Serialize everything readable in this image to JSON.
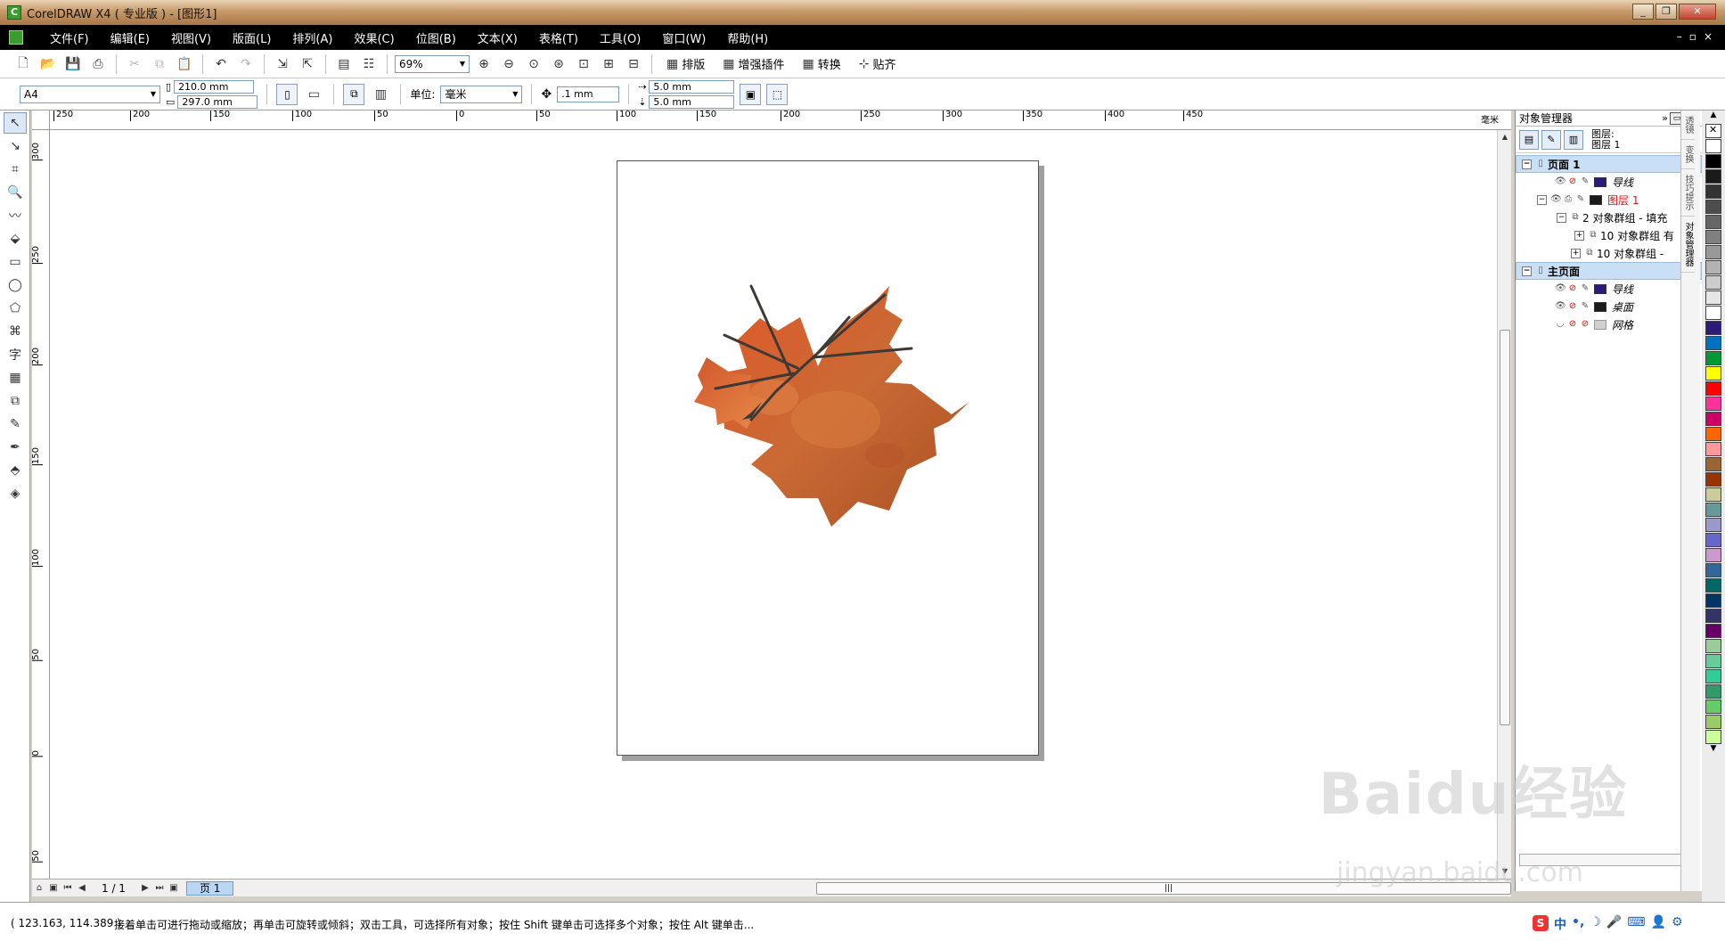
{
  "window": {
    "title": "CorelDRAW X4 ( 专业版 ) - [图形1]"
  },
  "menu": {
    "items": [
      "文件(F)",
      "编辑(E)",
      "视图(V)",
      "版面(L)",
      "排列(A)",
      "效果(C)",
      "位图(B)",
      "文本(X)",
      "表格(T)",
      "工具(O)",
      "窗口(W)",
      "帮助(H)"
    ]
  },
  "toolbar": {
    "zoom_value": "69%",
    "btn_layout": "排版",
    "btn_plugin": "增强插件",
    "btn_convert": "转换",
    "btn_snap": "贴齐"
  },
  "property_bar": {
    "paper_size": "A4",
    "width": "210.0 mm",
    "height": "297.0 mm",
    "unit_label": "单位:",
    "unit_value": "毫米",
    "nudge": ".1 mm",
    "dup_x": "5.0 mm",
    "dup_y": "5.0 mm"
  },
  "ruler": {
    "horizontal_labels": [
      "250",
      "200",
      "150",
      "100",
      "50",
      "0",
      "50",
      "100",
      "150",
      "200",
      "250",
      "300",
      "350",
      "400",
      "450"
    ],
    "h_unit": "毫米",
    "vertical_labels": [
      "300",
      "250",
      "200",
      "150",
      "100",
      "50",
      "0",
      "50"
    ]
  },
  "pagenav": {
    "count": "1 / 1",
    "tab": "页 1"
  },
  "status": {
    "coords": "( 123.163, 114.389 )",
    "hint": "接着单击可进行拖动或缩放；再单击可旋转或倾斜；双击工具，可选择所有对象；按住 Shift 键单击可选择多个对象；按住 Alt 键单击..."
  },
  "object_manager": {
    "title": "对象管理器",
    "layer_label_1": "图层:",
    "layer_label_2": "图层 1",
    "page1": "页面 1",
    "guides": "导线",
    "layer1": "图层 1",
    "group_2": "2 对象群组 - 填充",
    "group_10a": "10 对象群组 有",
    "group_10b": "10 对象群组 -",
    "master": "主页面",
    "master_guides": "导线",
    "master_desktop": "桌面",
    "master_grid": "网格"
  },
  "side_tabs": [
    "透镜",
    "变换",
    "技巧提示",
    "对象管理器"
  ],
  "palette": {
    "colors": [
      "#ffffff",
      "#000000",
      "#1a1a1a",
      "#333333",
      "#4d4d4d",
      "#666666",
      "#808080",
      "#999999",
      "#b3b3b3",
      "#cccccc",
      "#e6e6e6",
      "#ffffff",
      "#2e1a78",
      "#0070c0",
      "#009933",
      "#ffff00",
      "#ff0000",
      "#ff3399",
      "#cc0066",
      "#ff6600",
      "#ff9999",
      "#996633",
      "#993300",
      "#cccc99",
      "#669999",
      "#9999cc",
      "#6666cc",
      "#cc99cc",
      "#336699",
      "#006666",
      "#003366",
      "#333366",
      "#660066",
      "#99cc99",
      "#66cc99",
      "#33cc99",
      "#339966",
      "#66cc66",
      "#99cc66",
      "#ccff99"
    ]
  },
  "watermark": {
    "main": "Baidu经验",
    "sub": "jingyan.baidu.com"
  },
  "colors": {
    "leaf_dark": "#b8491a",
    "leaf_light": "#e07a3b",
    "vein": "#3d3a36"
  }
}
